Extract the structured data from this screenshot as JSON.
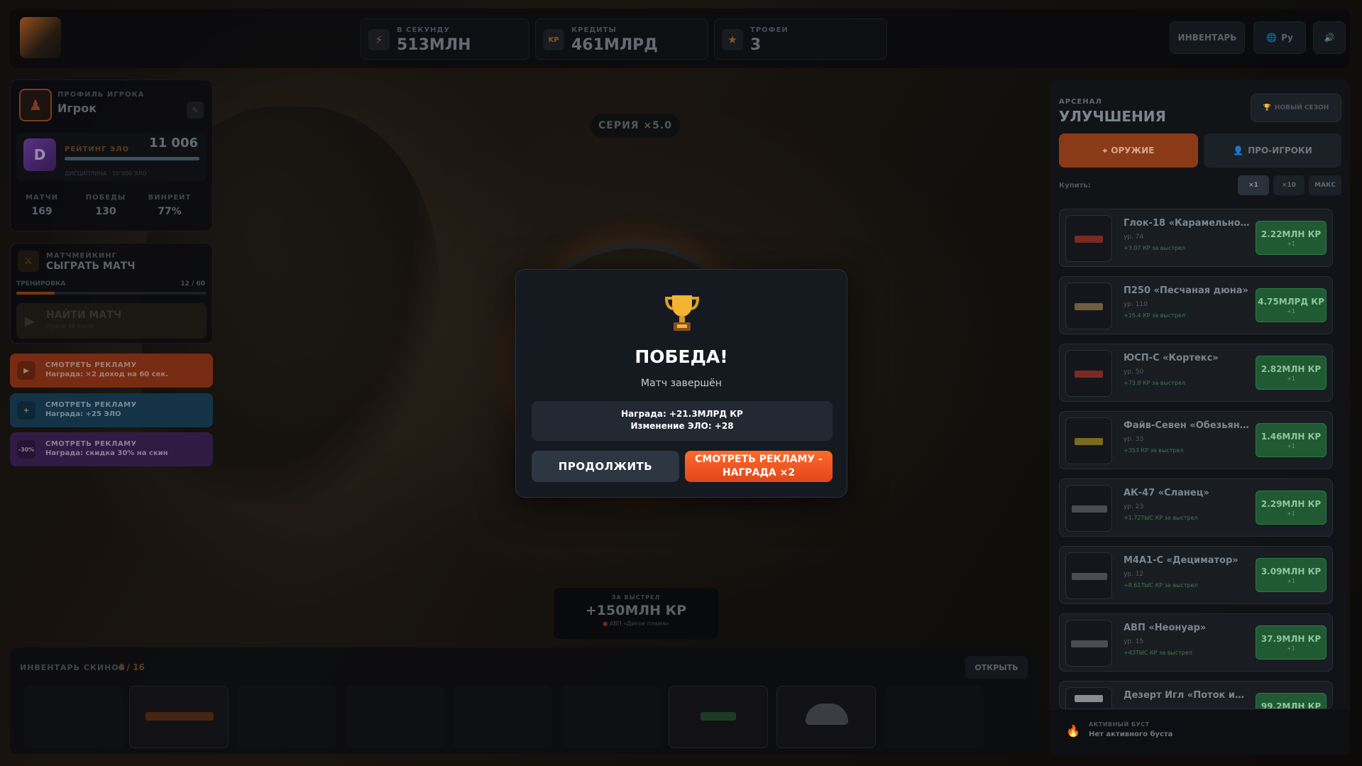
{
  "header": {
    "stats": [
      {
        "label": "В СЕКУНДУ",
        "value": "513МЛН",
        "icon": "lightning-icon"
      },
      {
        "label": "КРЕДИТЫ",
        "value": "461МЛРД",
        "icon": "kr-icon",
        "icon_text": "KP"
      },
      {
        "label": "ТРОФЕИ",
        "value": "3",
        "icon": "star-icon"
      }
    ],
    "inventory_button": "ИНВЕНТАРЬ",
    "language_button": "Ру"
  },
  "profile": {
    "section_label": "ПРОФИЛЬ ИГРОКА",
    "name": "Игрок",
    "rank_letter": "D",
    "elo_label": "РЕЙТИНГ ЭЛО",
    "elo_value": "11 006",
    "elo_progress_pct": 100,
    "rank_caption": "ДИСЦИПЛИНА · 10 000 ЭЛО",
    "stats": [
      {
        "label": "МАТЧИ",
        "value": "169"
      },
      {
        "label": "ПОБЕДЫ",
        "value": "130"
      },
      {
        "label": "ВИНРЕЙТ",
        "value": "77%"
      }
    ]
  },
  "matchmaking": {
    "section_label": "МАТЧМЕЙКИНГ",
    "title": "СЫГРАТЬ МАТЧ",
    "training_label": "ТРЕНИРОВКА",
    "training_progress": "12 / 60",
    "training_fraction": 0.2,
    "find_button": "НАЙТИ МАТЧ",
    "find_sub": "Нужно 48 очков"
  },
  "ads": [
    {
      "title": "СМОТРЕТЬ РЕКЛАМУ",
      "subtitle": "Награда: ×2 доход на 60 сек.",
      "icon_text": "▶",
      "color": "#b8431e"
    },
    {
      "title": "СМОТРЕТЬ РЕКЛАМУ",
      "subtitle": "Награда: +25 ЭЛО",
      "icon_text": "+",
      "color": "#1f4f6e"
    },
    {
      "title": "СМОТРЕТЬ РЕКЛАМУ",
      "subtitle": "Награда: скидка 30% на скин",
      "icon_text": "-30%",
      "color": "#4a2a6b"
    }
  ],
  "center": {
    "streak": "СЕРИЯ ×5.0",
    "per_shot_label": "ЗА ВЫСТРЕЛ",
    "per_shot_value": "+150МЛН КР",
    "per_shot_weapon": "АВП «Дикое пламя»"
  },
  "inventory": {
    "title": "ИНВЕНТАРЬ СКИНОВ",
    "count": "4 / 16",
    "open_button": "ОТКРЫТЬ"
  },
  "arsenal": {
    "section_label": "АРСЕНАЛ",
    "title": "УЛУЧШЕНИЯ",
    "new_season_button": "НОВЫЙ СЕЗОН",
    "tabs": [
      "ОРУЖИЕ",
      "ПРО-ИГРОКИ"
    ],
    "buy_label": "Купить:",
    "multipliers": [
      "×1",
      "×10",
      "МАКС"
    ],
    "items": [
      {
        "name": "Глок-18 «Карамельное ...",
        "level": "ур. 74",
        "gain": "+3.07 КР за выстрел",
        "price": "2.22МЛН КР",
        "qty": "+1"
      },
      {
        "name": "П250 «Песчаная дюна»",
        "level": "ур. 110",
        "gain": "+15.4 КР за выстрел",
        "price": "4.75МЛРД КР",
        "qty": "+1"
      },
      {
        "name": "ЮСП-С «Кортекс»",
        "level": "ур. 50",
        "gain": "+73.8 КР за выстрел",
        "price": "2.82МЛН КР",
        "qty": "+1"
      },
      {
        "name": "Файв-Севен «Обезьянь...",
        "level": "ур. 33",
        "gain": "+353 КР за выстрел",
        "price": "1.46МЛН КР",
        "qty": "+1"
      },
      {
        "name": "АК-47 «Сланец»",
        "level": "ур. 23",
        "gain": "+1.72ТЫС КР за выстрел",
        "price": "2.29МЛН КР",
        "qty": "+1"
      },
      {
        "name": "М4А1-С «Дециматор»",
        "level": "ур. 12",
        "gain": "+8.61ТЫС КР за выстрел",
        "price": "3.09МЛН КР",
        "qty": "+1"
      },
      {
        "name": "АВП «Неонуар»",
        "level": "ур. 15",
        "gain": "+43ТЫС КР за выстрел",
        "price": "37.9МЛН КР",
        "qty": "+1"
      },
      {
        "name": "Дезерт Игл «Поток инф...",
        "level": "",
        "gain": "",
        "price": "99.2МЛН КР",
        "qty": ""
      }
    ],
    "boost_label": "АКТИВНЫЙ БУСТ",
    "boost_value": "Нет активного буста"
  },
  "modal": {
    "title": "ПОБЕДА!",
    "subtitle": "Матч завершён",
    "reward": "Награда: +21.3МЛРД КР",
    "elo_change": "Изменение ЭЛО: +28",
    "continue_button": "ПРОДОЛЖИТЬ",
    "ad_button_line1": "СМОТРЕТЬ РЕКЛАМУ -",
    "ad_button_line2": "НАГРАДА ×2"
  }
}
